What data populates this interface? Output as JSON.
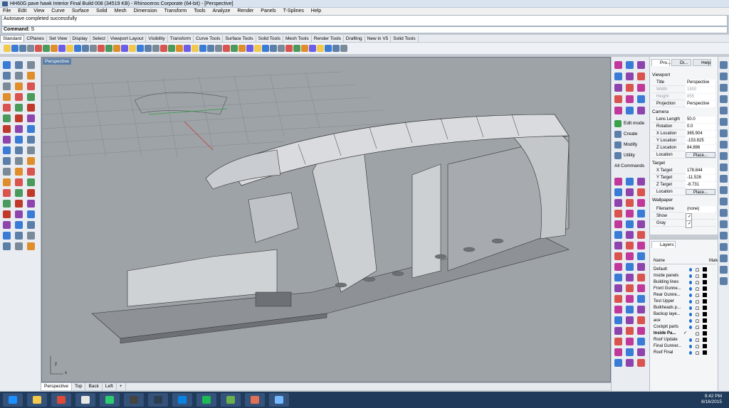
{
  "window": {
    "title": "HH60G pave hawk Interior Final Build 008 (34519 KB) - Rhinoceros Corporate (64-bit) - [Perspective]"
  },
  "menu": [
    "File",
    "Edit",
    "View",
    "Curve",
    "Surface",
    "Solid",
    "Mesh",
    "Dimension",
    "Transform",
    "Tools",
    "Analyze",
    "Render",
    "Panels",
    "T-Splines",
    "Help"
  ],
  "command": {
    "history": "Autosave completed successfully",
    "prompt": "Command:",
    "value": "S"
  },
  "toolbar_tabs": [
    "Standard",
    "CPlanes",
    "Set View",
    "Display",
    "Select",
    "Viewport Layout",
    "Visibility",
    "Transform",
    "Curve Tools",
    "Surface Tools",
    "Solid Tools",
    "Mesh Tools",
    "Render Tools",
    "Drafting",
    "New in V5",
    "Solid Tools"
  ],
  "viewport": {
    "title": "Perspective",
    "tabs": [
      "Perspective",
      "Top",
      "Back",
      "Left",
      "+"
    ],
    "axis_y": "y",
    "axis_x": "x"
  },
  "side_commands": [
    "Edit mode",
    "Create",
    "Modify",
    "Utility",
    "All Commands"
  ],
  "properties": {
    "tabs": [
      "Pro...",
      "Di...",
      "Help"
    ],
    "viewport_header": "Viewport",
    "viewport_rows": [
      {
        "k": "Title",
        "v": "Perspective"
      },
      {
        "k": "Width",
        "v": "1500"
      },
      {
        "k": "Height",
        "v": "855"
      },
      {
        "k": "Projection",
        "v": "Perspective"
      }
    ],
    "camera_header": "Camera",
    "camera_rows": [
      {
        "k": "Lens Length",
        "v": "50.0"
      },
      {
        "k": "Rotation",
        "v": "0.0"
      },
      {
        "k": "X Location",
        "v": "365.904"
      },
      {
        "k": "Y Location",
        "v": "-153.825"
      },
      {
        "k": "Z Location",
        "v": "84.896"
      },
      {
        "k": "Location",
        "v": "Place..."
      }
    ],
    "target_header": "Target",
    "target_rows": [
      {
        "k": "X Target",
        "v": "178.844"
      },
      {
        "k": "Y Target",
        "v": "-11.526"
      },
      {
        "k": "Z Target",
        "v": "-8.731"
      },
      {
        "k": "Location",
        "v": "Place..."
      }
    ],
    "wallpaper_header": "Wallpaper",
    "wallpaper_rows": [
      {
        "k": "Filename",
        "v": "(none)"
      },
      {
        "k": "Show",
        "v": "✓"
      },
      {
        "k": "Gray",
        "v": "✓"
      }
    ]
  },
  "layers": {
    "title": "Layers",
    "col_name": "Name",
    "col_mat": "Mate",
    "items": [
      "Default",
      "Inside panels",
      "Building lines",
      "Front Gunne...",
      "Rear Gunne...",
      "Test Upper",
      "Bulkheads p...",
      "Backup laye...",
      "ace",
      "Cockpit parts",
      "Inside Pa...",
      "Roof Update",
      "Final Gunner...",
      "Roof Final"
    ],
    "current_mark": "✓"
  },
  "clock": {
    "time": "9:42 PM",
    "date": "8/16/2015"
  },
  "colors": {
    "accent": "#5b7fa8",
    "taskbar": "#1f3a5a",
    "viewport_bg": "#9ea3a8"
  }
}
